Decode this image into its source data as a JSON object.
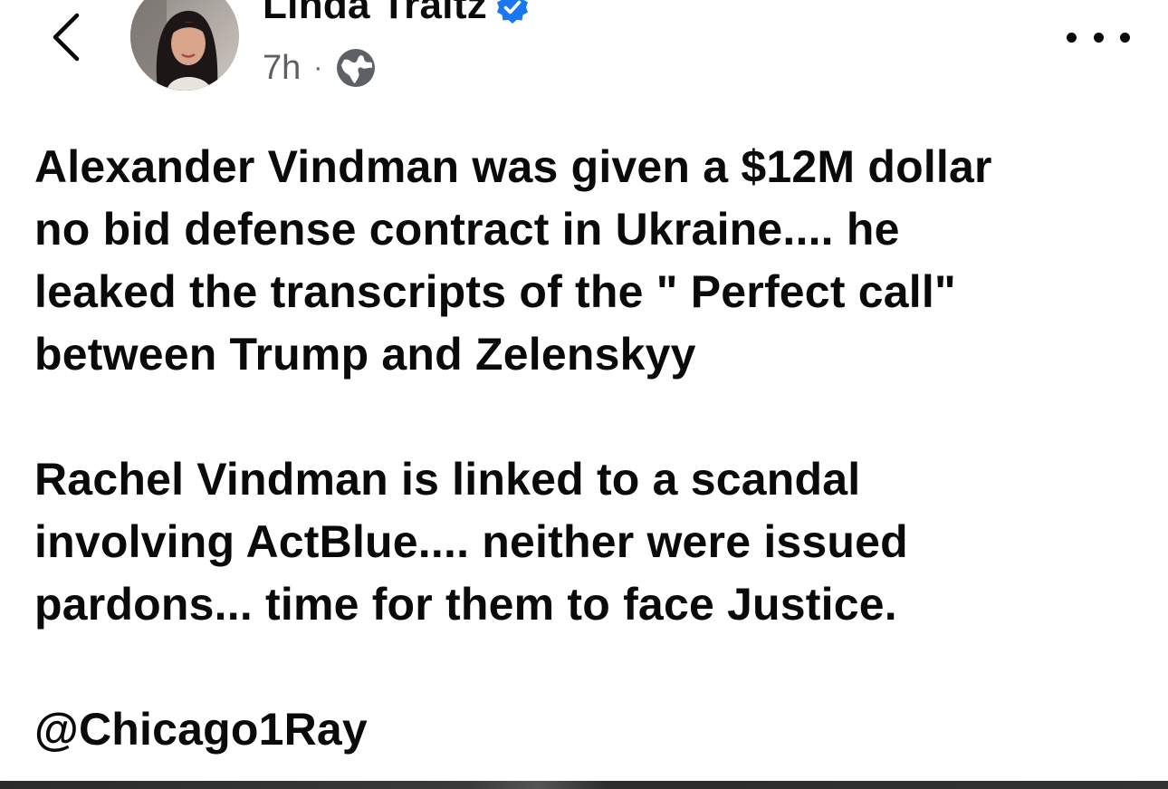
{
  "header": {
    "author_name": "Linda Traitz",
    "timestamp": "7h",
    "separator": "·",
    "audience_icon": "globe-icon",
    "back_icon": "chevron-left-icon",
    "more_icon": "more-horizontal-icon",
    "verified_icon": "verified-badge-icon"
  },
  "post": {
    "paragraph1": [
      "Alexander Vindman was given a $12M dollar",
      "no bid defense contract in Ukraine.... he",
      "leaked the transcripts of the \" Perfect call\"",
      "between Trump and Zelenskyy"
    ],
    "paragraph2": [
      "Rachel Vindman is linked to a scandal",
      "involving ActBlue.... neither were issued",
      "pardons... time for them to face Justice."
    ],
    "mention": "@Chicago1Ray"
  },
  "colors": {
    "verified": "#1877f2",
    "meta_text": "#5d6166",
    "text": "#0a0a0a"
  }
}
